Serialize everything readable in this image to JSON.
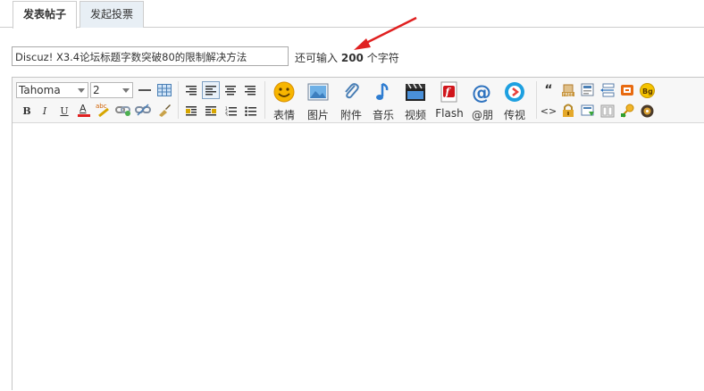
{
  "tabs": [
    {
      "label": "发表帖子",
      "active": true
    },
    {
      "label": "发起投票",
      "active": false
    }
  ],
  "subject": {
    "value": "Discuz! X3.4论坛标题字数突破80的限制解决方法",
    "remain_prefix": "还可输入",
    "remain_count": "200",
    "remain_suffix": "个字符"
  },
  "editor": {
    "font_family": "Tahoma",
    "font_size": "2",
    "format_buttons": [
      "B",
      "I",
      "U"
    ],
    "media_buttons": [
      {
        "label": "表情",
        "icon": "smiley-icon"
      },
      {
        "label": "图片",
        "icon": "image-icon"
      },
      {
        "label": "附件",
        "icon": "paperclip-icon"
      },
      {
        "label": "音乐",
        "icon": "music-note-icon"
      },
      {
        "label": "视频",
        "icon": "video-clapper-icon"
      },
      {
        "label": "Flash",
        "icon": "flash-icon"
      },
      {
        "label": "@朋",
        "icon": "at-icon"
      },
      {
        "label": "传视",
        "icon": "play-icon"
      }
    ],
    "bg_badge": "Bg",
    "code_glyph": "<>",
    "quote_glyph": "“"
  },
  "colors": {
    "tab_inactive_bg": "#e8eff5",
    "arrow": "#e02020",
    "toolbar_bg": "#f7f7f7"
  }
}
